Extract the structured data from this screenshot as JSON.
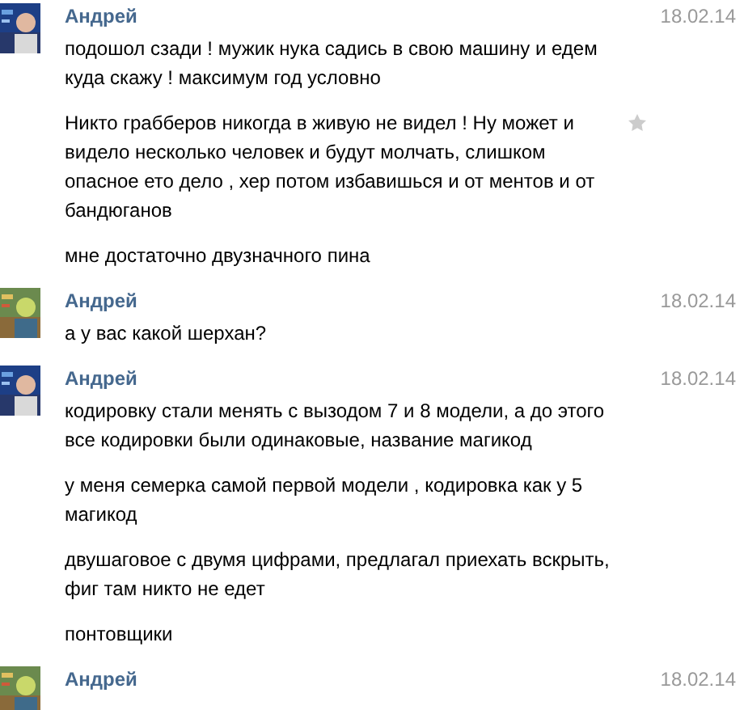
{
  "messages": [
    {
      "author": "Андрей",
      "date": "18.02.14",
      "avatar": {
        "kind": "picture"
      },
      "paragraphs": [
        {
          "text": "подошол сзади ! мужик нука садись в свою машину и едем куда скажу ! максимум год условно",
          "star": false
        },
        {
          "text": "Никто грабберов никогда в живую не видел ! Ну может и видело несколько человек и будут молчать, слишком опасное ето дело , хер потом избавишься и от ментов и от бандюганов",
          "star": true
        },
        {
          "text": "мне достаточно двузначного пина",
          "star": false
        }
      ]
    },
    {
      "author": "Андрей",
      "date": "18.02.14",
      "avatar": {
        "kind": "picture"
      },
      "paragraphs": [
        {
          "text": "а у вас какой шерхан?",
          "star": false
        }
      ]
    },
    {
      "author": "Андрей",
      "date": "18.02.14",
      "avatar": {
        "kind": "picture"
      },
      "paragraphs": [
        {
          "text": "кодировку стали менять с вызодом 7 и 8 модели, а до этого все кодировки были одинаковые, название магикод",
          "star": false
        },
        {
          "text": "у меня семерка самой первой модели , кодировка как у 5 магикод",
          "star": false
        },
        {
          "text": "двушаговое с двумя цифрами, предлагал приехать вскрыть, фиг там никто не едет",
          "star": false
        },
        {
          "text": "понтовщики",
          "star": false
        }
      ]
    },
    {
      "author": "Андрей",
      "date": "18.02.14",
      "avatar": {
        "kind": "picture"
      }
    }
  ]
}
